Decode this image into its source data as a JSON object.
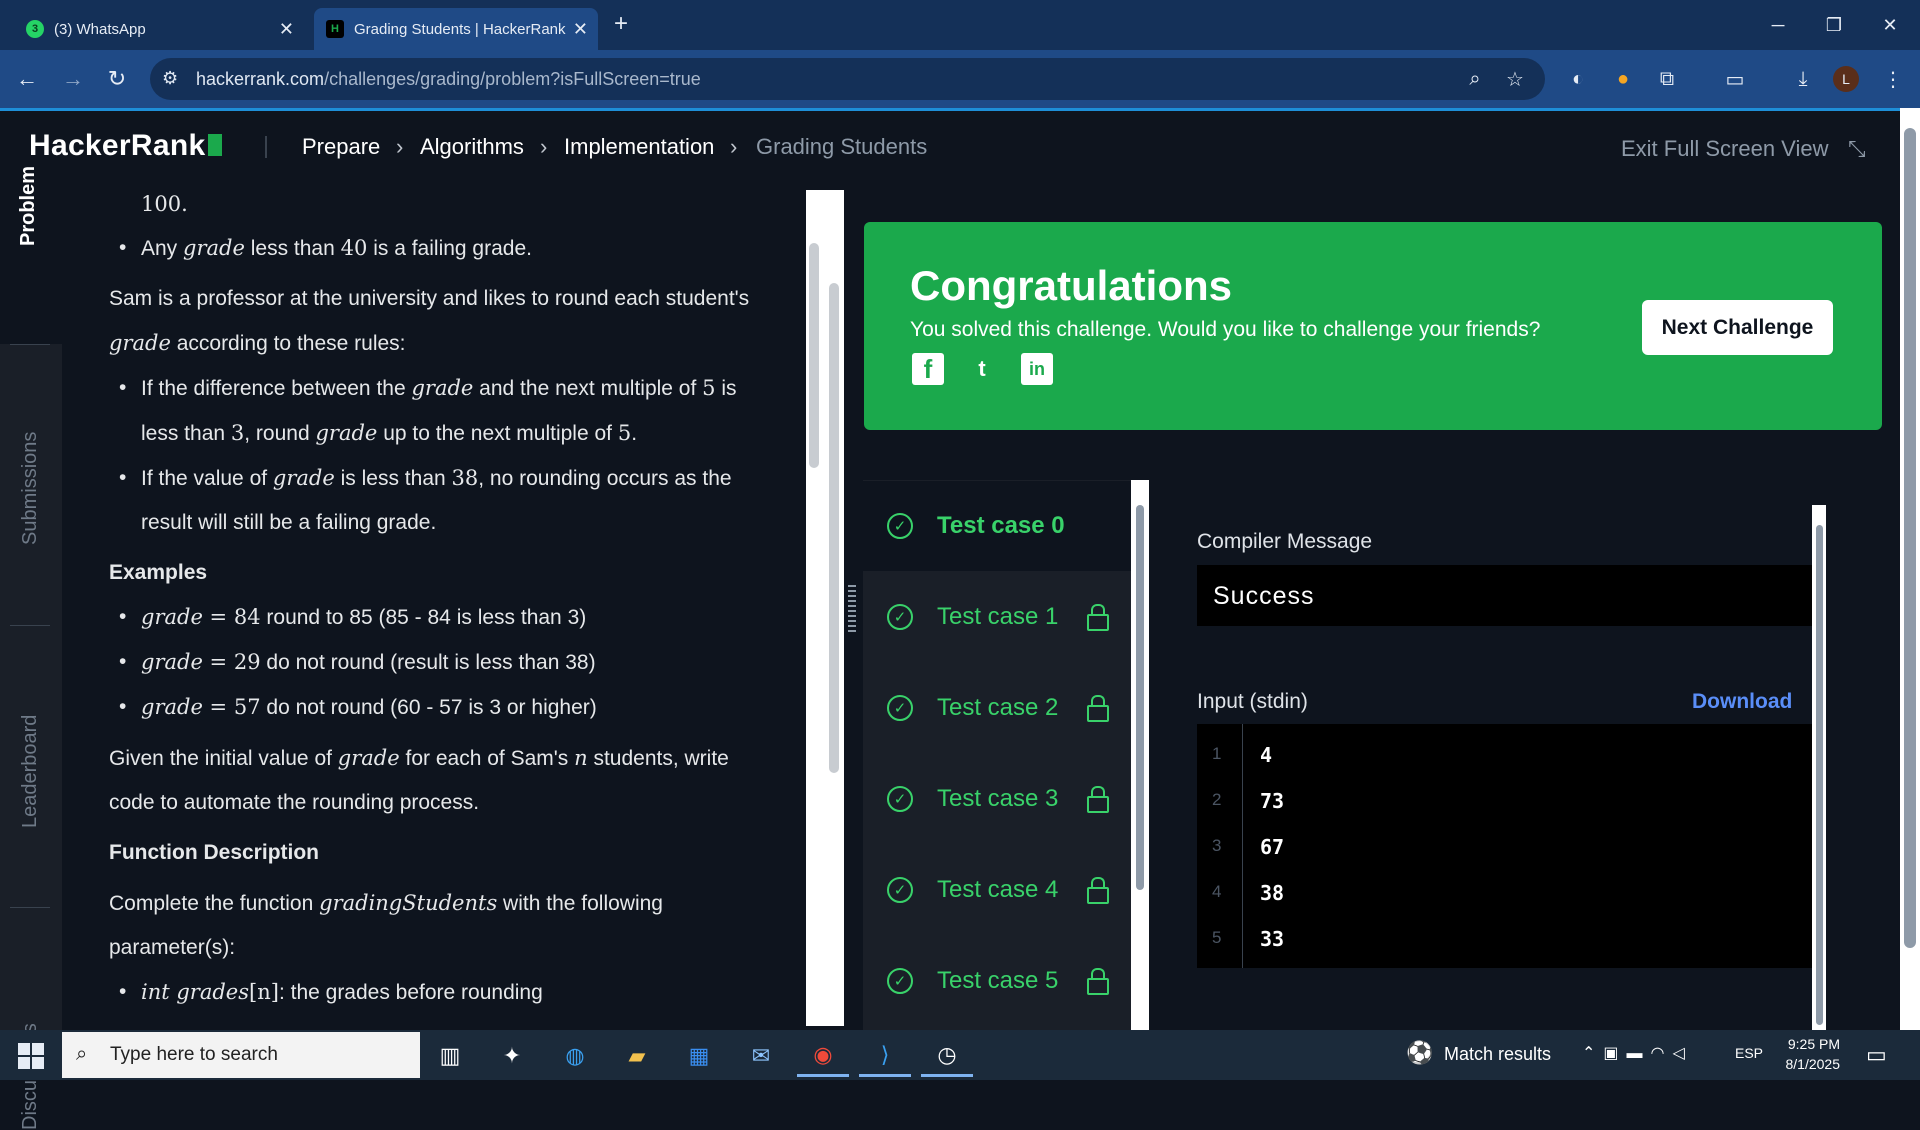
{
  "browser": {
    "tabs": [
      {
        "label": "(3) WhatsApp",
        "badge": "3",
        "active": false
      },
      {
        "label": "Grading Students | HackerRank",
        "badge": "H",
        "active": true
      }
    ],
    "new_tab": "+",
    "url_host": "hackerrank.com",
    "url_path": "/challenges/grading/problem?isFullScreen=true",
    "profile_initial": "L"
  },
  "header": {
    "logo": "HackerRank",
    "breadcrumbs": [
      "Prepare",
      "Algorithms",
      "Implementation",
      "Grading Students"
    ],
    "exit_fullscreen": "Exit Full Screen View"
  },
  "leftnav": {
    "items": [
      "Problem",
      "Submissions",
      "Leaderboard",
      "Discussions"
    ]
  },
  "problem": {
    "line_top": "100.",
    "fail_rule_a": "Any ",
    "fail_rule_var": "grade",
    "fail_rule_b": " less than ",
    "fail_rule_num": "40",
    "fail_rule_c": " is a failing grade.",
    "intro_a": "Sam is a professor at the university and likes to round each student's ",
    "intro_var": "grade",
    "intro_b": " according to these rules:",
    "rule1_a": "If the difference between the ",
    "rule1_var": "grade",
    "rule1_b": " and the next multiple of ",
    "rule1_n1": "5",
    "rule1_c": " is less than ",
    "rule1_n2": "3",
    "rule1_d": ", round ",
    "rule1_var2": "grade",
    "rule1_e": " up to the next multiple of ",
    "rule1_n3": "5",
    "rule1_f": ".",
    "rule2_a": "If the value of ",
    "rule2_var": "grade",
    "rule2_b": " is less than ",
    "rule2_n": "38",
    "rule2_c": ", no rounding occurs as the result will still be a failing grade.",
    "examples_heading": "Examples",
    "examples": [
      {
        "var": "grade",
        "eq": " = ",
        "val": "84",
        "text": " round to 85 (85 - 84 is less than 3)"
      },
      {
        "var": "grade",
        "eq": " = ",
        "val": "29",
        "text": " do not round (result is less than 38)"
      },
      {
        "var": "grade",
        "eq": " = ",
        "val": "57",
        "text": " do not round (60 - 57 is 3 or higher)"
      }
    ],
    "given_a": "Given the initial value of ",
    "given_var": "grade",
    "given_b": " for each of Sam's ",
    "given_var2": "n",
    "given_c": " students, write code to automate the rounding process.",
    "func_heading": "Function Description",
    "func_a": "Complete the function ",
    "func_var": "gradingStudents",
    "func_b": " with the following parameter(s):",
    "param_var": "int grades",
    "param_idx": "[n]",
    "param_text": ": the grades before rounding"
  },
  "result": {
    "title": "Congratulations",
    "subtitle": "You solved this challenge. Would you like to challenge your friends?",
    "next_button": "Next Challenge",
    "social": [
      "f",
      "t",
      "in"
    ]
  },
  "testcases": [
    "Test case 0",
    "Test case 1",
    "Test case 2",
    "Test case 3",
    "Test case 4",
    "Test case 5"
  ],
  "output": {
    "compiler_label": "Compiler Message",
    "compiler_message": "Success",
    "input_label": "Input (stdin)",
    "download": "Download",
    "lines": [
      {
        "n": "1",
        "v": "4"
      },
      {
        "n": "2",
        "v": "73"
      },
      {
        "n": "3",
        "v": "67"
      },
      {
        "n": "4",
        "v": "38"
      },
      {
        "n": "5",
        "v": "33"
      }
    ]
  },
  "taskbar": {
    "search_placeholder": "Type here to search",
    "match_results": "Match results",
    "lang": "ESP",
    "time": "9:25 PM",
    "date": "8/1/2025"
  },
  "colors": {
    "accent_green": "#1ba94c",
    "testcase_green": "#39d26a",
    "link_blue": "#5a8ef8",
    "bg_dark": "#0e141e"
  }
}
